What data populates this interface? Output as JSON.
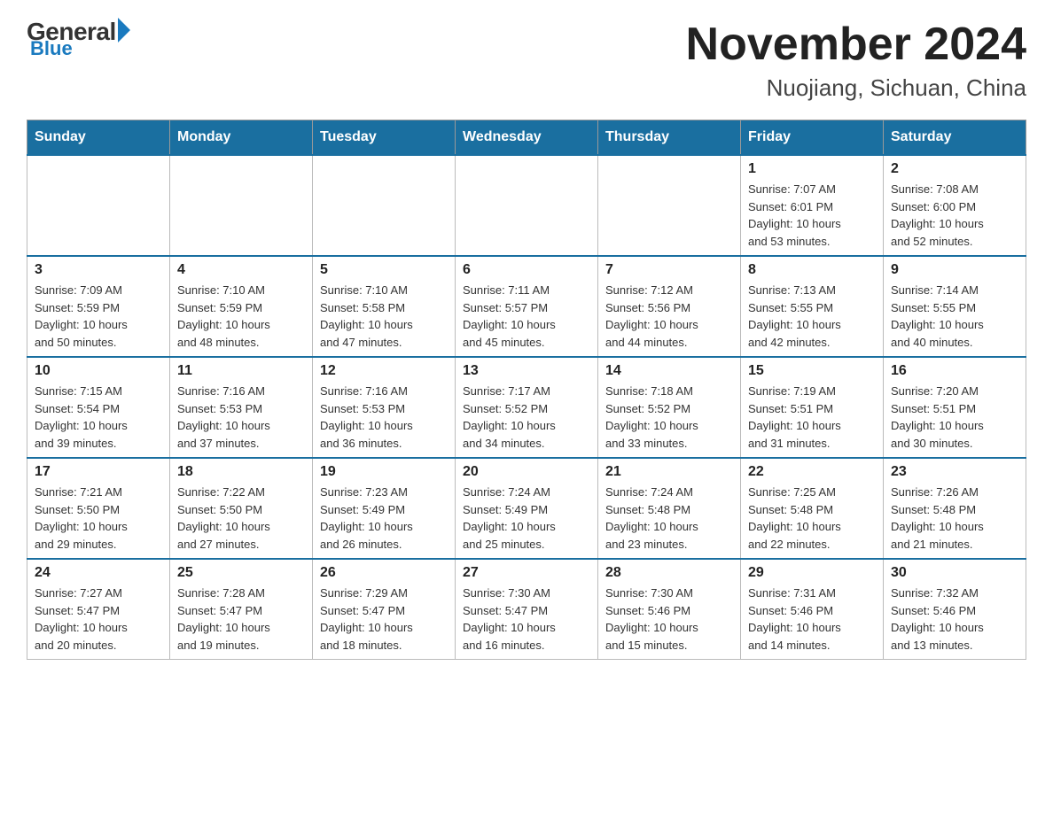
{
  "header": {
    "logo": {
      "general": "General",
      "blue": "Blue"
    },
    "title": "November 2024",
    "location": "Nuojiang, Sichuan, China"
  },
  "days_of_week": [
    "Sunday",
    "Monday",
    "Tuesday",
    "Wednesday",
    "Thursday",
    "Friday",
    "Saturday"
  ],
  "weeks": [
    [
      {
        "day": "",
        "info": ""
      },
      {
        "day": "",
        "info": ""
      },
      {
        "day": "",
        "info": ""
      },
      {
        "day": "",
        "info": ""
      },
      {
        "day": "",
        "info": ""
      },
      {
        "day": "1",
        "info": "Sunrise: 7:07 AM\nSunset: 6:01 PM\nDaylight: 10 hours\nand 53 minutes."
      },
      {
        "day": "2",
        "info": "Sunrise: 7:08 AM\nSunset: 6:00 PM\nDaylight: 10 hours\nand 52 minutes."
      }
    ],
    [
      {
        "day": "3",
        "info": "Sunrise: 7:09 AM\nSunset: 5:59 PM\nDaylight: 10 hours\nand 50 minutes."
      },
      {
        "day": "4",
        "info": "Sunrise: 7:10 AM\nSunset: 5:59 PM\nDaylight: 10 hours\nand 48 minutes."
      },
      {
        "day": "5",
        "info": "Sunrise: 7:10 AM\nSunset: 5:58 PM\nDaylight: 10 hours\nand 47 minutes."
      },
      {
        "day": "6",
        "info": "Sunrise: 7:11 AM\nSunset: 5:57 PM\nDaylight: 10 hours\nand 45 minutes."
      },
      {
        "day": "7",
        "info": "Sunrise: 7:12 AM\nSunset: 5:56 PM\nDaylight: 10 hours\nand 44 minutes."
      },
      {
        "day": "8",
        "info": "Sunrise: 7:13 AM\nSunset: 5:55 PM\nDaylight: 10 hours\nand 42 minutes."
      },
      {
        "day": "9",
        "info": "Sunrise: 7:14 AM\nSunset: 5:55 PM\nDaylight: 10 hours\nand 40 minutes."
      }
    ],
    [
      {
        "day": "10",
        "info": "Sunrise: 7:15 AM\nSunset: 5:54 PM\nDaylight: 10 hours\nand 39 minutes."
      },
      {
        "day": "11",
        "info": "Sunrise: 7:16 AM\nSunset: 5:53 PM\nDaylight: 10 hours\nand 37 minutes."
      },
      {
        "day": "12",
        "info": "Sunrise: 7:16 AM\nSunset: 5:53 PM\nDaylight: 10 hours\nand 36 minutes."
      },
      {
        "day": "13",
        "info": "Sunrise: 7:17 AM\nSunset: 5:52 PM\nDaylight: 10 hours\nand 34 minutes."
      },
      {
        "day": "14",
        "info": "Sunrise: 7:18 AM\nSunset: 5:52 PM\nDaylight: 10 hours\nand 33 minutes."
      },
      {
        "day": "15",
        "info": "Sunrise: 7:19 AM\nSunset: 5:51 PM\nDaylight: 10 hours\nand 31 minutes."
      },
      {
        "day": "16",
        "info": "Sunrise: 7:20 AM\nSunset: 5:51 PM\nDaylight: 10 hours\nand 30 minutes."
      }
    ],
    [
      {
        "day": "17",
        "info": "Sunrise: 7:21 AM\nSunset: 5:50 PM\nDaylight: 10 hours\nand 29 minutes."
      },
      {
        "day": "18",
        "info": "Sunrise: 7:22 AM\nSunset: 5:50 PM\nDaylight: 10 hours\nand 27 minutes."
      },
      {
        "day": "19",
        "info": "Sunrise: 7:23 AM\nSunset: 5:49 PM\nDaylight: 10 hours\nand 26 minutes."
      },
      {
        "day": "20",
        "info": "Sunrise: 7:24 AM\nSunset: 5:49 PM\nDaylight: 10 hours\nand 25 minutes."
      },
      {
        "day": "21",
        "info": "Sunrise: 7:24 AM\nSunset: 5:48 PM\nDaylight: 10 hours\nand 23 minutes."
      },
      {
        "day": "22",
        "info": "Sunrise: 7:25 AM\nSunset: 5:48 PM\nDaylight: 10 hours\nand 22 minutes."
      },
      {
        "day": "23",
        "info": "Sunrise: 7:26 AM\nSunset: 5:48 PM\nDaylight: 10 hours\nand 21 minutes."
      }
    ],
    [
      {
        "day": "24",
        "info": "Sunrise: 7:27 AM\nSunset: 5:47 PM\nDaylight: 10 hours\nand 20 minutes."
      },
      {
        "day": "25",
        "info": "Sunrise: 7:28 AM\nSunset: 5:47 PM\nDaylight: 10 hours\nand 19 minutes."
      },
      {
        "day": "26",
        "info": "Sunrise: 7:29 AM\nSunset: 5:47 PM\nDaylight: 10 hours\nand 18 minutes."
      },
      {
        "day": "27",
        "info": "Sunrise: 7:30 AM\nSunset: 5:47 PM\nDaylight: 10 hours\nand 16 minutes."
      },
      {
        "day": "28",
        "info": "Sunrise: 7:30 AM\nSunset: 5:46 PM\nDaylight: 10 hours\nand 15 minutes."
      },
      {
        "day": "29",
        "info": "Sunrise: 7:31 AM\nSunset: 5:46 PM\nDaylight: 10 hours\nand 14 minutes."
      },
      {
        "day": "30",
        "info": "Sunrise: 7:32 AM\nSunset: 5:46 PM\nDaylight: 10 hours\nand 13 minutes."
      }
    ]
  ]
}
